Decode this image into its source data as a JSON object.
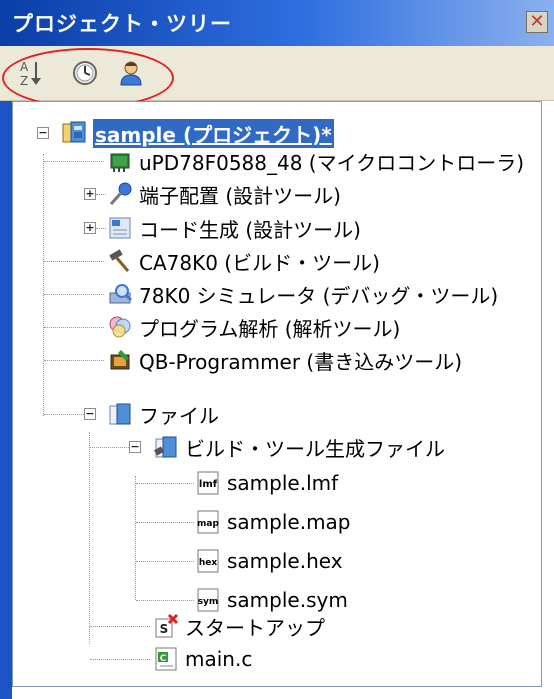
{
  "panel": {
    "title": "プロジェクト・ツリー",
    "close_glyph": "✕",
    "toolbar": [
      {
        "icon": "sort-az-icon"
      },
      {
        "icon": "clock-icon"
      },
      {
        "icon": "person-icon"
      }
    ]
  },
  "tree": {
    "project": "sample (プロジェクト)*",
    "microcontroller": "uPD78F0588_48 (マイクロコントローラ)",
    "pin_config": "端子配置 (設計ツール)",
    "code_gen": "コード生成 (設計ツール)",
    "build_tool": "CA78K0 (ビルド・ツール)",
    "debug_tool": "78K0 シミュレータ (デバッグ・ツール)",
    "analysis": "プログラム解析 (解析ツール)",
    "writer": "QB-Programmer (書き込みツール)",
    "files": "ファイル",
    "build_files": "ビルド・ツール生成ファイル",
    "lmf": "sample.lmf",
    "map": "sample.map",
    "hex": "sample.hex",
    "sym": "sample.sym",
    "startup": "スタートアップ",
    "main": "main.c",
    "icon_labels": {
      "lmf": "lmf",
      "map": "map",
      "hex": "hex",
      "sym": "sym",
      "c": "C",
      "s": "S"
    }
  },
  "colors": {
    "title_bar": "#0a3ea8",
    "selection": "#316ac5",
    "highlight_ring": "#e0231e"
  }
}
